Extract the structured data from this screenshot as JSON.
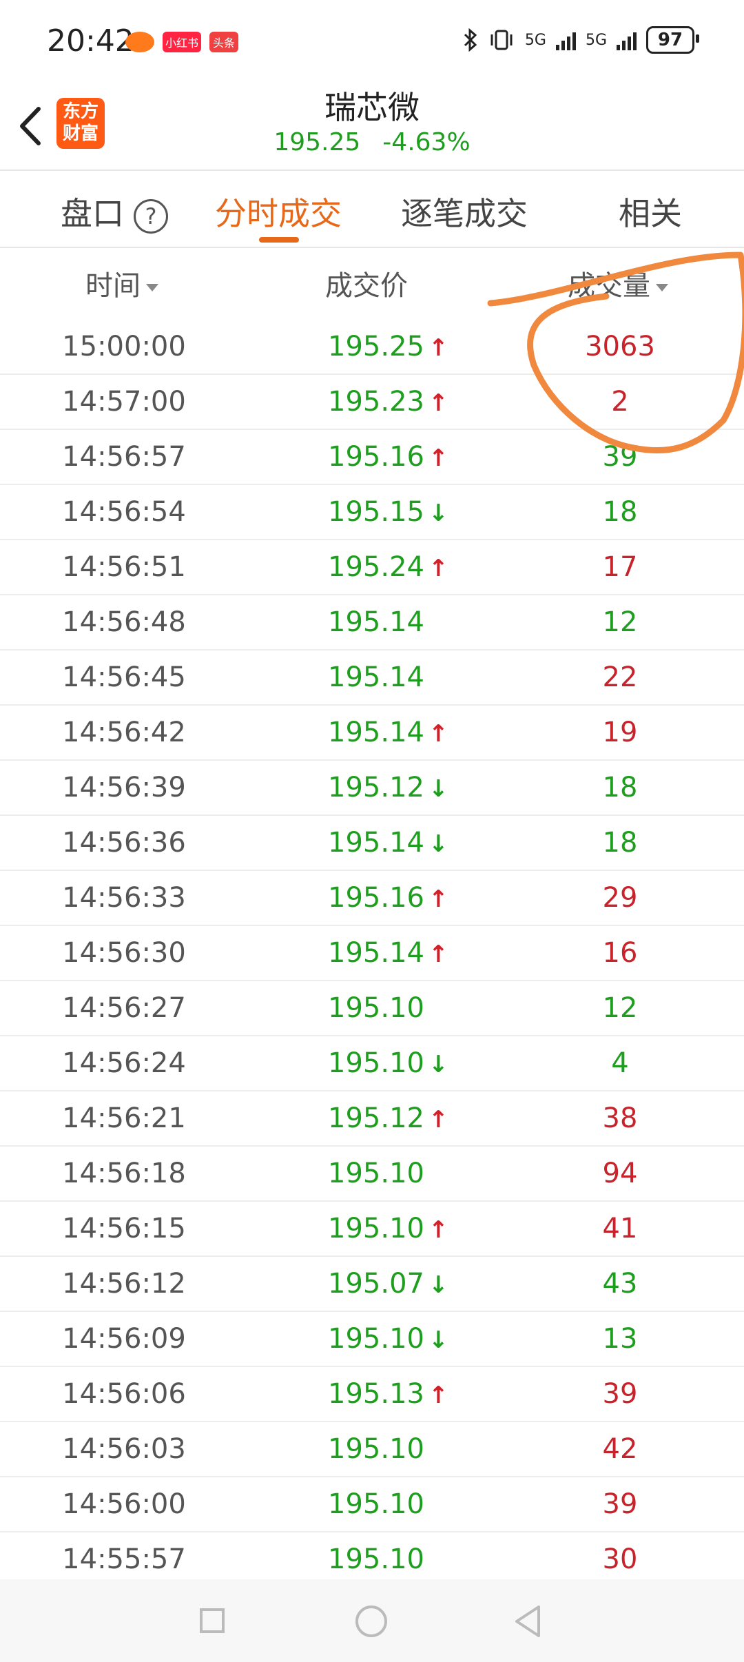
{
  "status_bar": {
    "time": "20:42",
    "badges": [
      {
        "text": "",
        "color": "#ff7a1a"
      },
      {
        "text": "小红书",
        "color": "#ff2442"
      },
      {
        "text": "头条",
        "color": "#f04142"
      }
    ],
    "network_1": "5G",
    "network_2": "5G",
    "battery": "97"
  },
  "header": {
    "logo_text": "东方财富",
    "stock_name": "瑞芯微",
    "price": "195.25",
    "change_pct": "-4.63%"
  },
  "tabs": [
    {
      "label": "盘口",
      "active": false
    },
    {
      "label": "分时成交",
      "active": true
    },
    {
      "label": "逐笔成交",
      "active": false
    },
    {
      "label": "相关",
      "active": false
    }
  ],
  "columns": {
    "time": "时间",
    "price": "成交价",
    "volume": "成交量"
  },
  "trades": [
    {
      "time": "15:00:00",
      "price": "195.25",
      "dir": "up",
      "volume": "3063",
      "vol_dir": "up"
    },
    {
      "time": "14:57:00",
      "price": "195.23",
      "dir": "up",
      "volume": "2",
      "vol_dir": "up"
    },
    {
      "time": "14:56:57",
      "price": "195.16",
      "dir": "up",
      "volume": "39",
      "vol_dir": "down"
    },
    {
      "time": "14:56:54",
      "price": "195.15",
      "dir": "down",
      "volume": "18",
      "vol_dir": "down"
    },
    {
      "time": "14:56:51",
      "price": "195.24",
      "dir": "up",
      "volume": "17",
      "vol_dir": "up"
    },
    {
      "time": "14:56:48",
      "price": "195.14",
      "dir": "",
      "volume": "12",
      "vol_dir": "down"
    },
    {
      "time": "14:56:45",
      "price": "195.14",
      "dir": "",
      "volume": "22",
      "vol_dir": "up"
    },
    {
      "time": "14:56:42",
      "price": "195.14",
      "dir": "up",
      "volume": "19",
      "vol_dir": "up"
    },
    {
      "time": "14:56:39",
      "price": "195.12",
      "dir": "down",
      "volume": "18",
      "vol_dir": "down"
    },
    {
      "time": "14:56:36",
      "price": "195.14",
      "dir": "down",
      "volume": "18",
      "vol_dir": "down"
    },
    {
      "time": "14:56:33",
      "price": "195.16",
      "dir": "up",
      "volume": "29",
      "vol_dir": "up"
    },
    {
      "time": "14:56:30",
      "price": "195.14",
      "dir": "up",
      "volume": "16",
      "vol_dir": "up"
    },
    {
      "time": "14:56:27",
      "price": "195.10",
      "dir": "",
      "volume": "12",
      "vol_dir": "down"
    },
    {
      "time": "14:56:24",
      "price": "195.10",
      "dir": "down",
      "volume": "4",
      "vol_dir": "down"
    },
    {
      "time": "14:56:21",
      "price": "195.12",
      "dir": "up",
      "volume": "38",
      "vol_dir": "up"
    },
    {
      "time": "14:56:18",
      "price": "195.10",
      "dir": "",
      "volume": "94",
      "vol_dir": "up"
    },
    {
      "time": "14:56:15",
      "price": "195.10",
      "dir": "up",
      "volume": "41",
      "vol_dir": "up"
    },
    {
      "time": "14:56:12",
      "price": "195.07",
      "dir": "down",
      "volume": "43",
      "vol_dir": "down"
    },
    {
      "time": "14:56:09",
      "price": "195.10",
      "dir": "down",
      "volume": "13",
      "vol_dir": "down"
    },
    {
      "time": "14:56:06",
      "price": "195.13",
      "dir": "up",
      "volume": "39",
      "vol_dir": "up"
    },
    {
      "time": "14:56:03",
      "price": "195.10",
      "dir": "",
      "volume": "42",
      "vol_dir": "up"
    },
    {
      "time": "14:56:00",
      "price": "195.10",
      "dir": "",
      "volume": "39",
      "vol_dir": "up"
    },
    {
      "time": "14:55:57",
      "price": "195.10",
      "dir": "",
      "volume": "30",
      "vol_dir": "up"
    }
  ],
  "colors": {
    "accent": "#e8681a",
    "up": "#d21f2a",
    "down": "#1e9e1e",
    "annotation": "#f0883e"
  }
}
